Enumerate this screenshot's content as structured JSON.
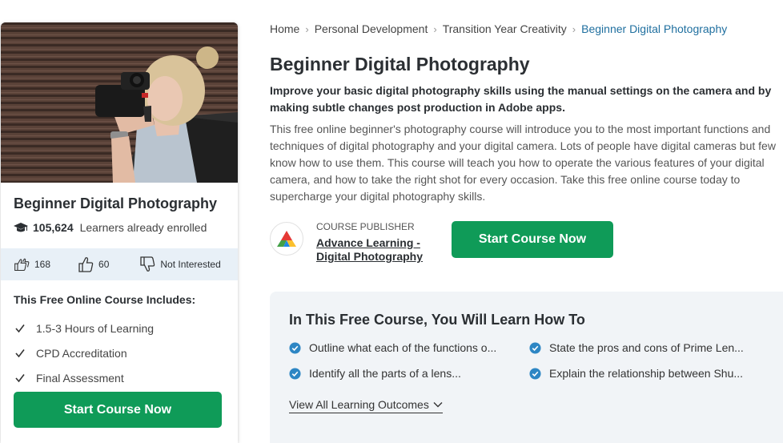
{
  "card": {
    "title": "Beginner Digital Photography",
    "enrolled_count": "105,624",
    "enrolled_text": "Learners already enrolled",
    "likes": "168",
    "thumbs_up": "60",
    "not_interested": "Not Interested",
    "includes_title": "This Free Online Course Includes:",
    "includes": [
      "1.5-3 Hours of Learning",
      "CPD Accreditation",
      "Final Assessment"
    ],
    "button": "Start Course Now"
  },
  "breadcrumb": [
    "Home",
    "Personal Development",
    "Transition Year Creativity",
    "Beginner Digital Photography"
  ],
  "course": {
    "title": "Beginner Digital Photography",
    "subtitle": "Improve your basic digital photography skills using the manual settings on the camera and by making subtle changes post production in Adobe apps.",
    "description": "This free online beginner's photography course will introduce you to the most important functions and techniques of digital photography and your digital camera. Lots of people have digital cameras but few know how to use them. This course will teach you how to operate the various features of your digital camera, and how to take the right shot for every occasion. Take this free online course today to supercharge your digital photography skills."
  },
  "publisher": {
    "label": "Course Publisher",
    "name": "Advance Learning - Digital Photography"
  },
  "main_button": "Start Course Now",
  "learn": {
    "title": "In This Free Course, You Will Learn How To",
    "outcomes": [
      "Outline what each of the functions o...",
      "State the pros and cons of Prime Len...",
      "Identify all the parts of a lens...",
      "Explain the relationship between Shu..."
    ],
    "view_all": "View All Learning Outcomes"
  },
  "colors": {
    "primary_green": "#0f9b58",
    "link_blue": "#1f6f9f",
    "check_blue": "#2d86c4",
    "feedback_bar": "#e8f0f7",
    "learn_panel": "#f1f4f7"
  }
}
